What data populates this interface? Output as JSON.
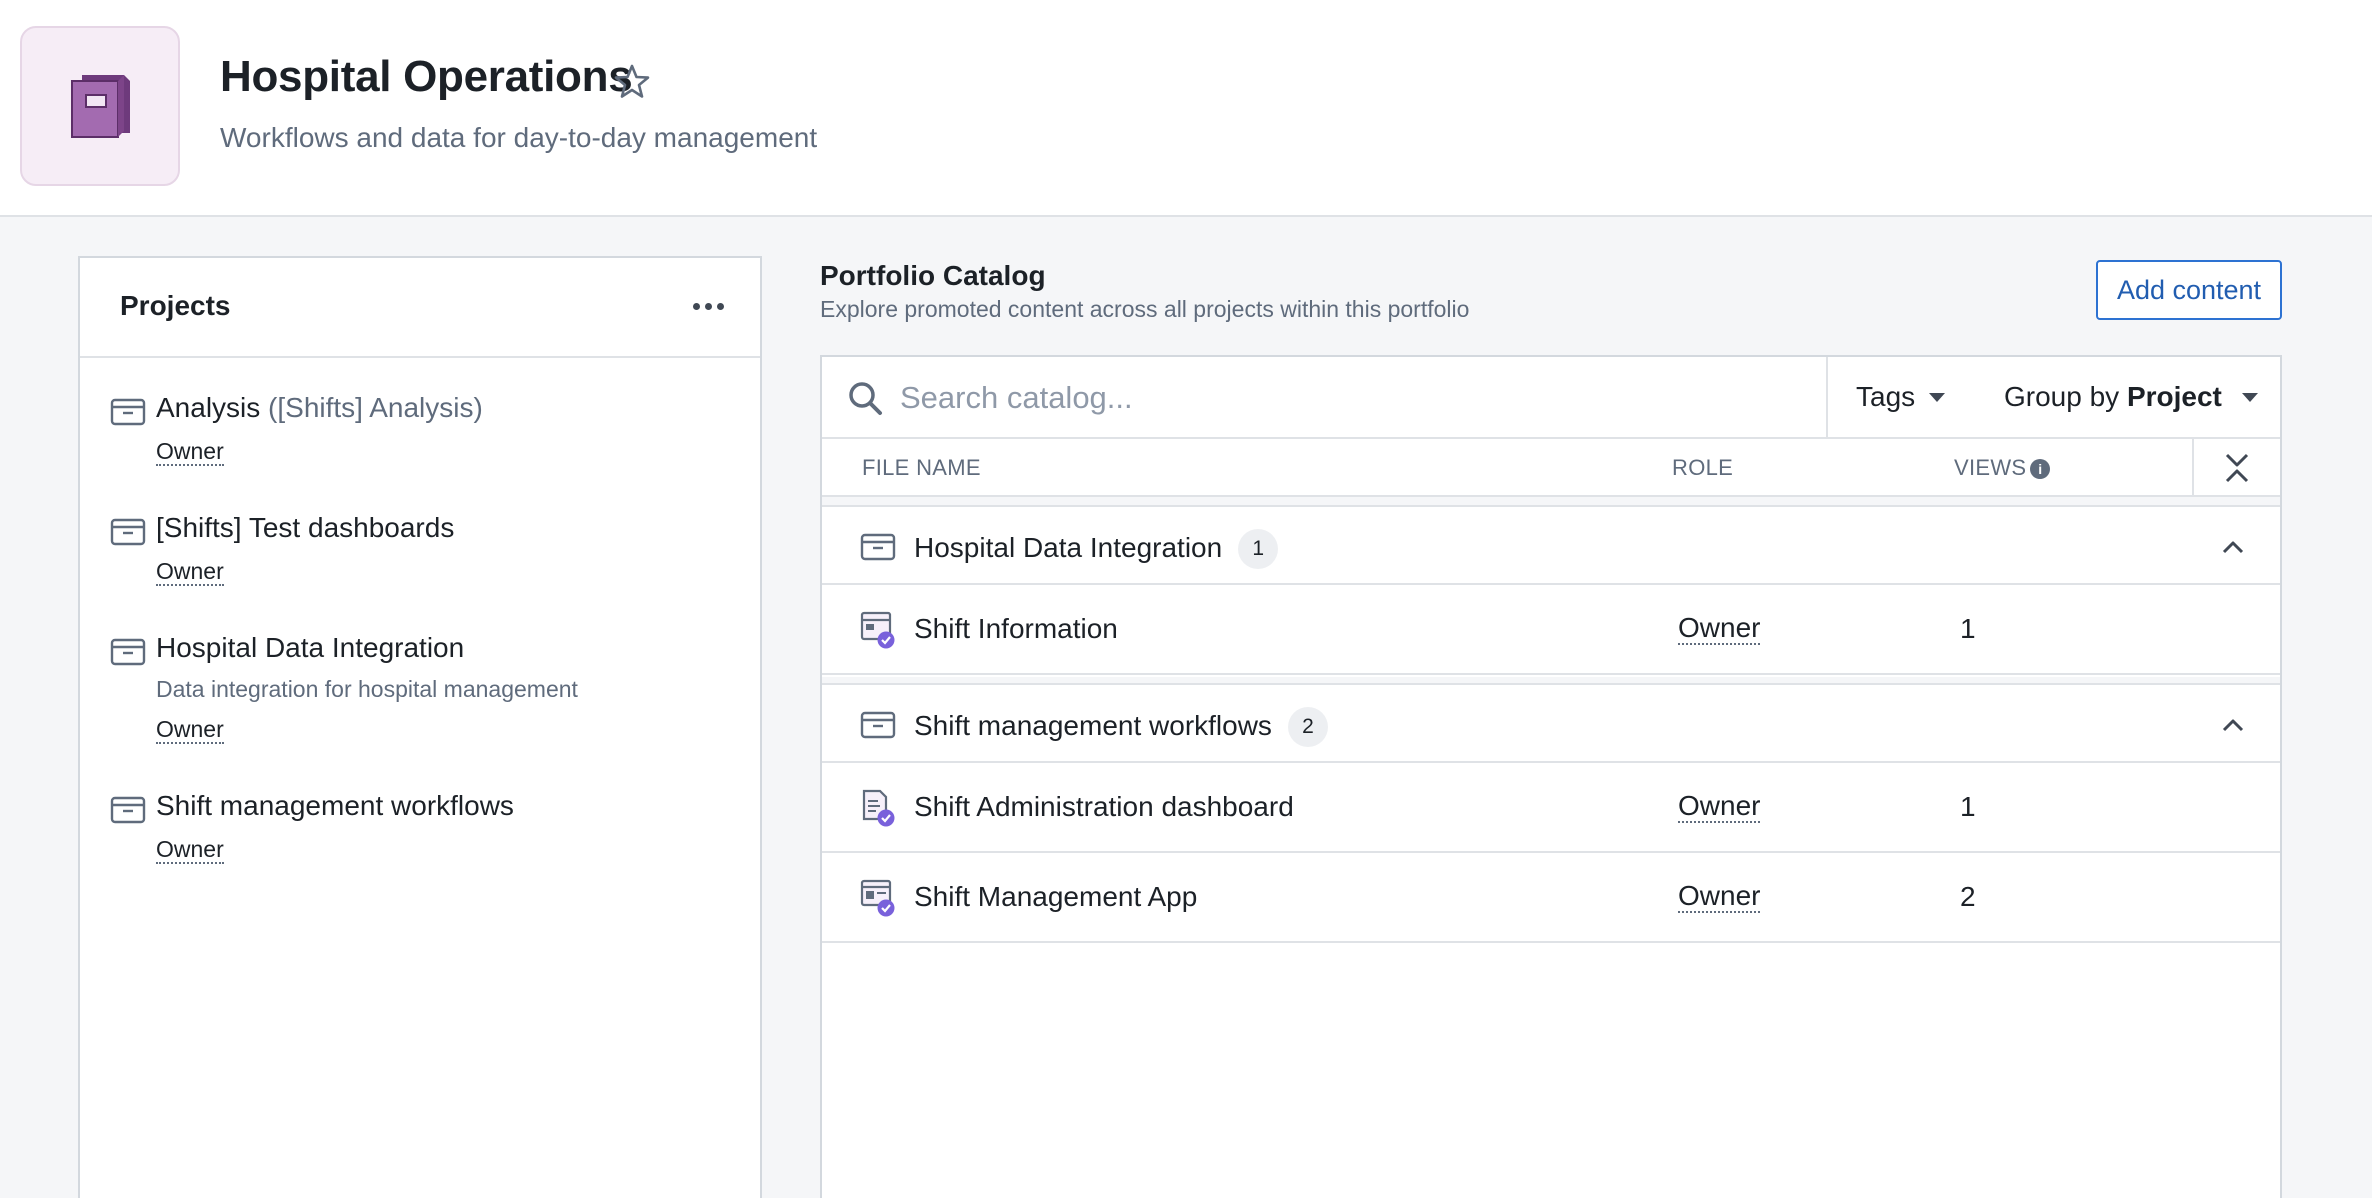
{
  "header": {
    "title": "Hospital Operations",
    "subtitle": "Workflows and data for day-to-day management",
    "icon": "portfolio-book-icon",
    "accent_color": "#8c4d99"
  },
  "projects_panel": {
    "title": "Projects",
    "items": [
      {
        "name": "Analysis",
        "alias": "([Shifts] Analysis)",
        "description": "",
        "role": "Owner"
      },
      {
        "name": "[Shifts] Test dashboards",
        "alias": "",
        "description": "",
        "role": "Owner"
      },
      {
        "name": "Hospital Data Integration",
        "alias": "",
        "description": "Data integration for hospital management",
        "role": "Owner"
      },
      {
        "name": "Shift management workflows",
        "alias": "",
        "description": "",
        "role": "Owner"
      }
    ]
  },
  "catalog": {
    "title": "Portfolio Catalog",
    "subtitle": "Explore promoted content across all projects within this portfolio",
    "add_button": "Add content",
    "search_placeholder": "Search catalog...",
    "tags_label": "Tags",
    "group_by_prefix": "Group by",
    "group_by_value": "Project",
    "columns": {
      "file_name": "FILE NAME",
      "role": "ROLE",
      "views": "VIEWS"
    },
    "groups": [
      {
        "name": "Hospital Data Integration",
        "count": "1",
        "items": [
          {
            "name": "Shift Information",
            "role": "Owner",
            "views": "1",
            "icon": "object-type-icon"
          }
        ]
      },
      {
        "name": "Shift management workflows",
        "count": "2",
        "items": [
          {
            "name": "Shift Administration dashboard",
            "role": "Owner",
            "views": "1",
            "icon": "dashboard-icon"
          },
          {
            "name": "Shift Management App",
            "role": "Owner",
            "views": "2",
            "icon": "application-icon"
          }
        ]
      }
    ]
  }
}
